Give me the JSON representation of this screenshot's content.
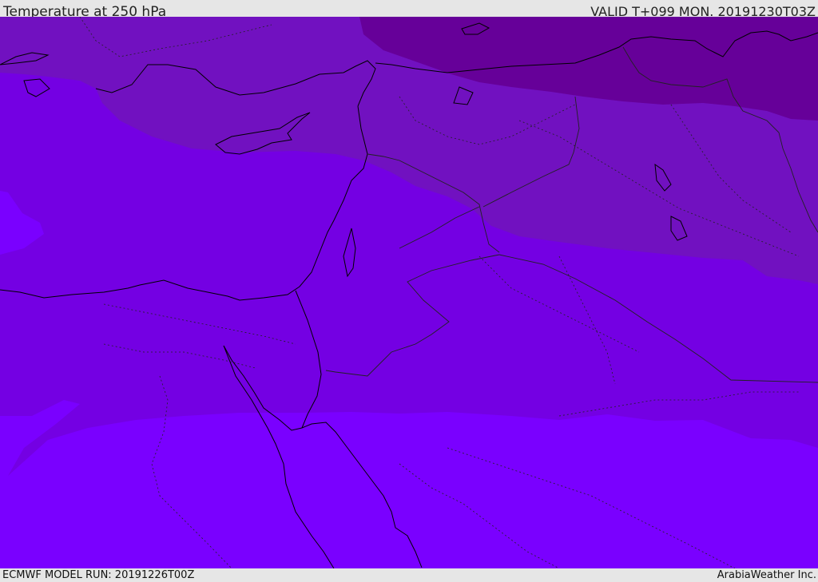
{
  "header": {
    "title": "Temperature at 250 hPa",
    "valid": "VALID T+099 MON. 20191230T03Z"
  },
  "footer": {
    "model_run": "ECMWF MODEL RUN: 20191226T00Z",
    "credit": "ArabiaWeather Inc."
  },
  "map": {
    "variable": "temperature",
    "level_hpa": 250,
    "colors": {
      "warmest_band": "#7a00ff",
      "band_2": "#7400e3",
      "band_3": "#7111c0",
      "coldest_band": "#660099",
      "coastline": "#000000",
      "border": "#222222"
    }
  }
}
